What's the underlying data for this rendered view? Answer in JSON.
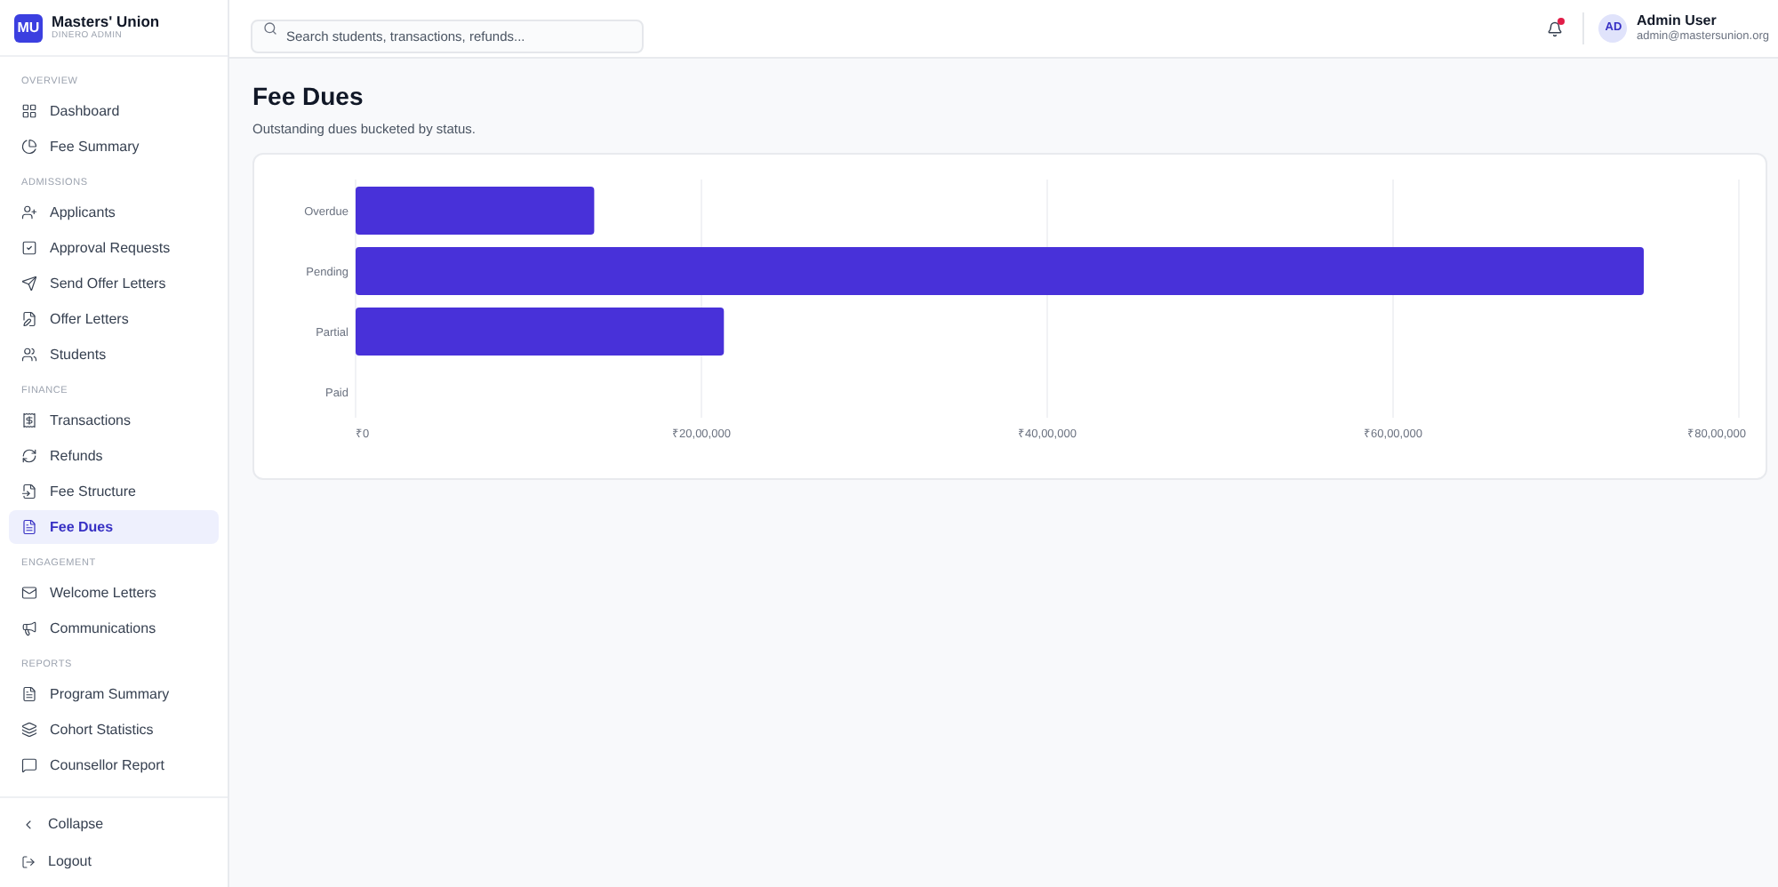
{
  "brand": {
    "logo": "MU",
    "name": "Masters' Union",
    "subtitle": "DINERO ADMIN"
  },
  "sidebar": {
    "sections": [
      {
        "label": "OVERVIEW",
        "items": [
          {
            "label": "Dashboard",
            "selected": false
          },
          {
            "label": "Fee Summary",
            "selected": false
          }
        ]
      },
      {
        "label": "ADMISSIONS",
        "items": [
          {
            "label": "Applicants",
            "selected": false
          },
          {
            "label": "Approval Requests",
            "selected": false
          },
          {
            "label": "Send Offer Letters",
            "selected": false
          },
          {
            "label": "Offer Letters",
            "selected": false
          },
          {
            "label": "Students",
            "selected": false
          }
        ]
      },
      {
        "label": "FINANCE",
        "items": [
          {
            "label": "Transactions",
            "selected": false
          },
          {
            "label": "Refunds",
            "selected": false
          },
          {
            "label": "Fee Structure",
            "selected": false
          },
          {
            "label": "Fee Dues",
            "selected": true
          }
        ]
      },
      {
        "label": "ENGAGEMENT",
        "items": [
          {
            "label": "Welcome Letters",
            "selected": false
          },
          {
            "label": "Communications",
            "selected": false
          }
        ]
      },
      {
        "label": "REPORTS",
        "items": [
          {
            "label": "Program Summary",
            "selected": false
          },
          {
            "label": "Cohort Statistics",
            "selected": false
          },
          {
            "label": "Counsellor Report",
            "selected": false
          }
        ]
      }
    ],
    "footer": [
      "Collapse",
      "Logout"
    ]
  },
  "header": {
    "search": {
      "placeholder": "Search students, transactions, refunds..."
    },
    "notifications_unread": true,
    "user": {
      "initials": "AD",
      "name": "Admin User",
      "email": "admin@mastersunion.org"
    }
  },
  "page": {
    "title": "Fee Dues",
    "subtitle": "Outstanding dues bucketed by status.",
    "chart_data": {
      "type": "bar",
      "orientation": "horizontal",
      "categories": [
        "Overdue",
        "Pending",
        "Partial",
        "Paid"
      ],
      "grid": true,
      "series": [
        {
          "color": "#4831d9",
          "values": [
            1380000,
            7450000,
            2130000,
            0
          ]
        }
      ],
      "xlim": [
        0,
        8000000
      ],
      "xticks": [
        {
          "value": 0,
          "label": "₹0"
        },
        {
          "value": 2000000,
          "label": "₹20,00,000"
        },
        {
          "value": 4000000,
          "label": "₹40,00,000"
        },
        {
          "value": 6000000,
          "label": "₹60,00,000"
        },
        {
          "value": 8000000,
          "label": "₹80,00,000"
        }
      ]
    }
  }
}
